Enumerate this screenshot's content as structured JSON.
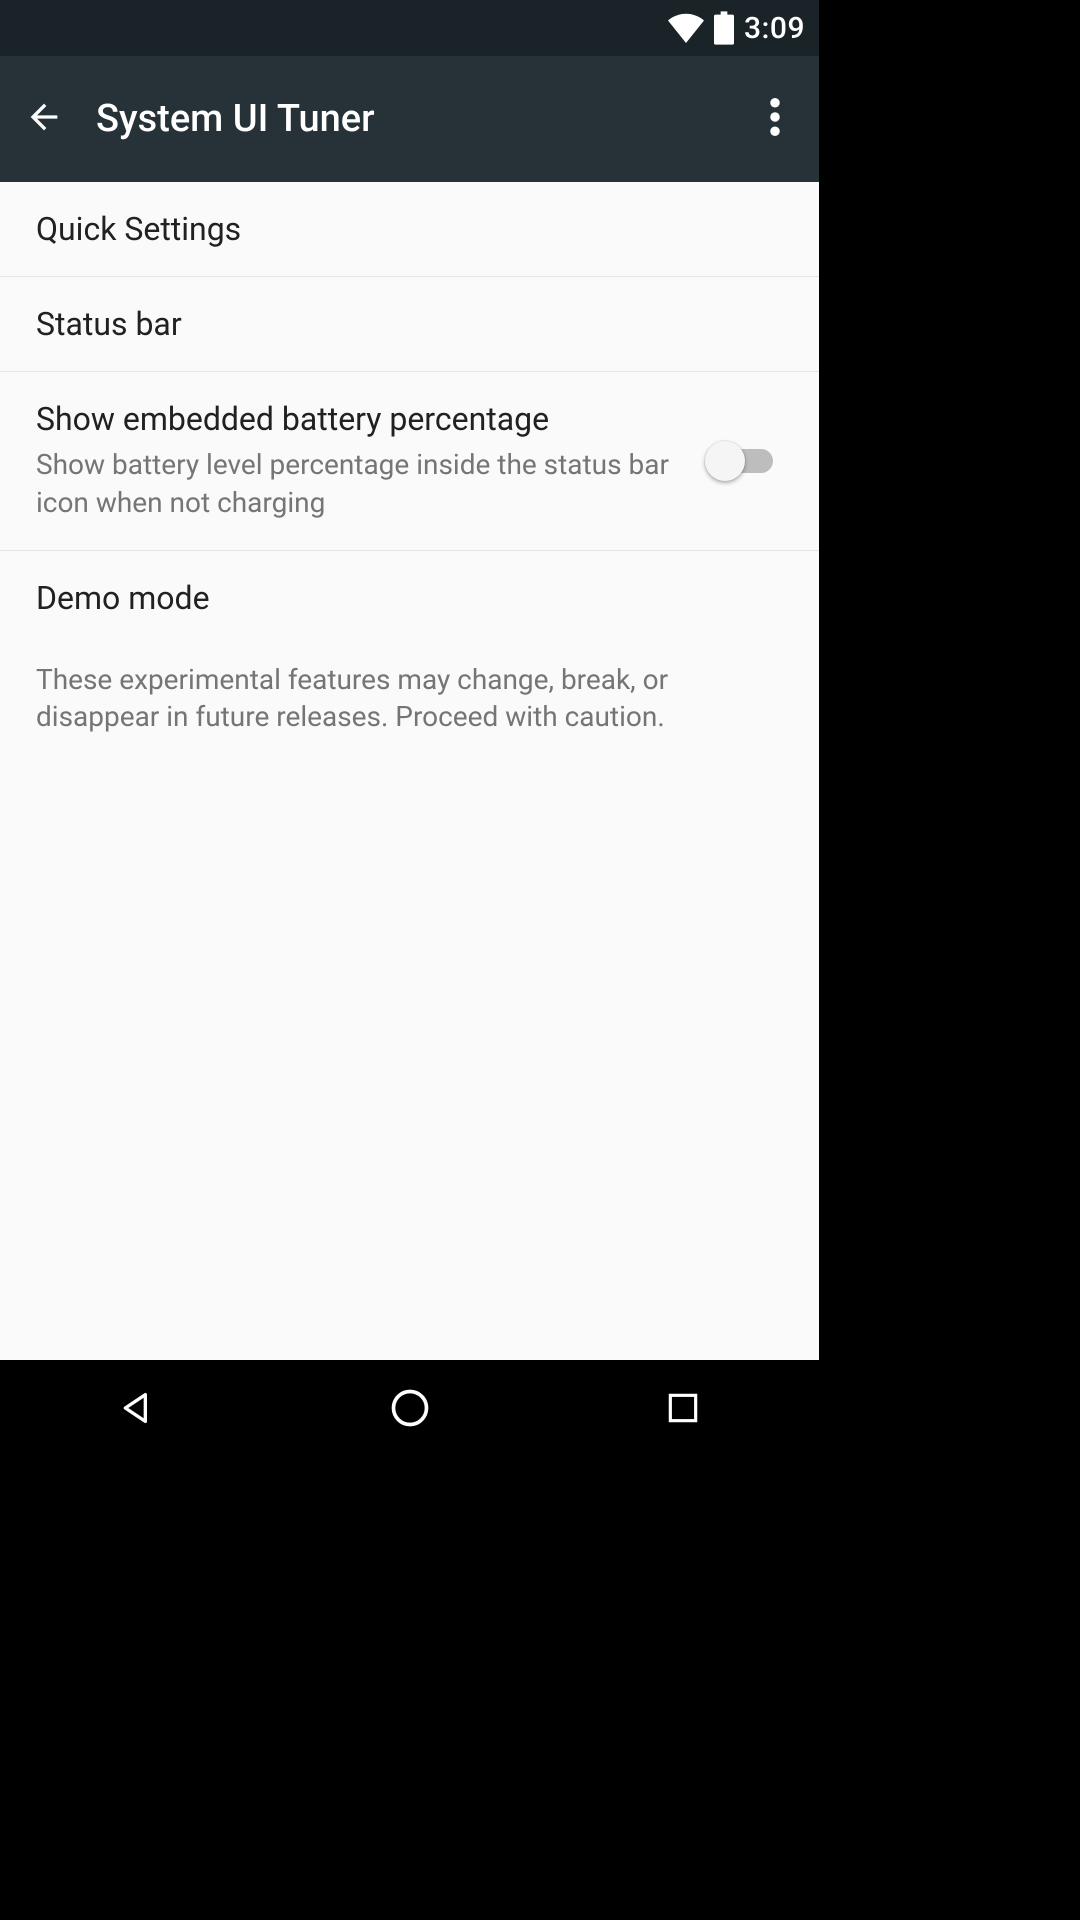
{
  "statusbar": {
    "time": "3:09"
  },
  "appbar": {
    "title": "System UI Tuner"
  },
  "rows": {
    "quick_settings": {
      "title": "Quick Settings"
    },
    "status_bar": {
      "title": "Status bar"
    },
    "battery_pct": {
      "title": "Show embedded battery percentage",
      "sub": "Show battery level percentage inside the status bar icon when not charging",
      "enabled": false
    },
    "demo_mode": {
      "title": "Demo mode"
    },
    "footer": "These experimental features may change, break, or disappear in future releases. Proceed with caution."
  }
}
